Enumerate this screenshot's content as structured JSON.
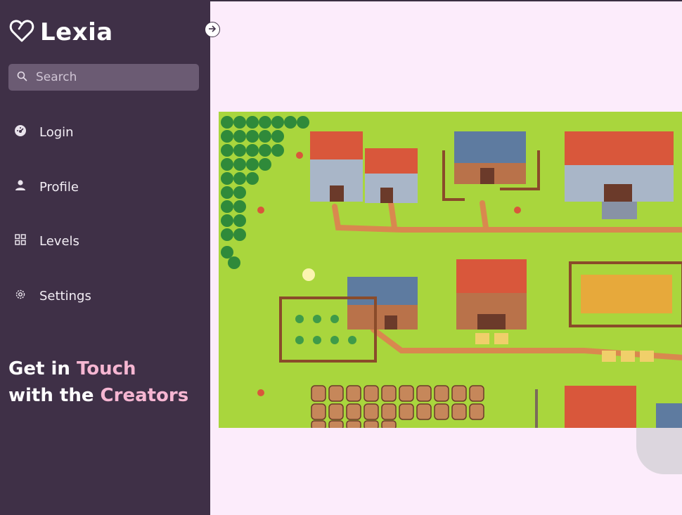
{
  "brand": {
    "name": "Lexia",
    "logo_icon": "heart-outline-logo-icon"
  },
  "search": {
    "placeholder": "Search",
    "icon": "search-icon"
  },
  "nav": [
    {
      "label": "Login",
      "icon": "dashboard-gauge-icon"
    },
    {
      "label": "Profile",
      "icon": "user-icon"
    },
    {
      "label": "Levels",
      "icon": "grid-icon"
    },
    {
      "label": "Settings",
      "icon": "gear-icon"
    }
  ],
  "promo": {
    "line1_a": "Get in ",
    "line1_b": "Touch",
    "line2_a": "with the ",
    "line2_b": "Creators"
  },
  "colors": {
    "sidebar": "#3f3047",
    "page_bg": "#fcecfb",
    "accent": "#f6b6d2",
    "search_bg": "#6b5b73",
    "grass": "#a9d63d"
  },
  "game_image": {
    "subject": "pixel-art farming village map"
  }
}
